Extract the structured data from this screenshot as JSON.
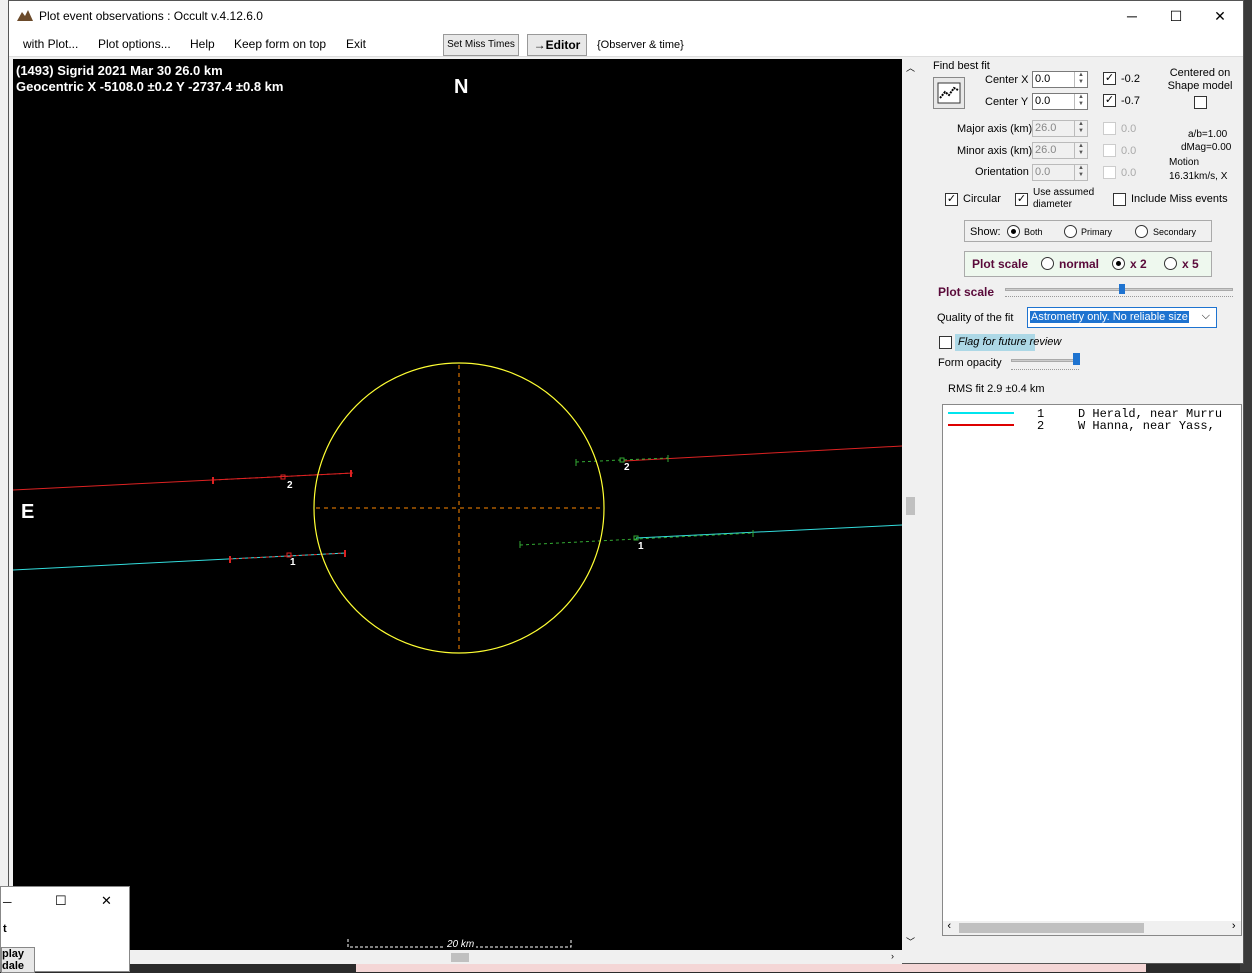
{
  "window": {
    "title": "Plot event observations : Occult v.4.12.6.0",
    "minimize": "─",
    "maximize": "☐",
    "close": "✕"
  },
  "menu": {
    "with_plot": "with Plot...",
    "plot_options": "Plot options...",
    "help": "Help",
    "keep_on_top": "Keep form on top",
    "exit": "Exit",
    "set_miss_times": "Set Miss Times",
    "editor": "→Editor",
    "observer_time": "{Observer & time}"
  },
  "plot": {
    "line1": "(1493) Sigrid  2021 Mar 30   26.0 km",
    "line2": "Geocentric  X  -5108.0 ±0.2  Y -2737.4 ±0.8 km",
    "north": "N",
    "east": "E",
    "scale_label": "20 km",
    "chord_labels": [
      "2",
      "1",
      "2",
      "1"
    ],
    "colors": {
      "ellipse": "#ffff33",
      "cyan": "#33dddd",
      "red": "#dd2222",
      "green": "#33aa33",
      "axes": "#ff8800"
    }
  },
  "panel": {
    "find_best_fit": "Find best fit",
    "center_x_label": "Center X",
    "center_x": "0.0",
    "center_y_label": "Center Y",
    "center_y": "0.0",
    "cx_fit": "-0.2",
    "cy_fit": "-0.7",
    "centered_on": "Centered on Shape model",
    "major_label": "Major axis (km)",
    "major": "26.0",
    "minor_label": "Minor axis (km)",
    "minor": "26.0",
    "orient_label": "Orientation",
    "orient": "0.0",
    "major_fit": "0.0",
    "minor_fit": "0.0",
    "orient_fit": "0.0",
    "ab": "a/b=1.00",
    "dmag": "dMag=0.00",
    "motion_label": "Motion",
    "motion": "16.31km/s, X",
    "circular": "Circular",
    "use_assumed": "Use assumed diameter",
    "include_miss": "Include Miss events",
    "show_label": "Show:",
    "show_both": "Both",
    "show_primary": "Primary",
    "show_secondary": "Secondary",
    "plot_scale_label": "Plot scale",
    "scale_normal": "normal",
    "scale_x2": "x 2",
    "scale_x5": "x 5",
    "plot_scale_slider_label": "Plot scale",
    "quality_label": "Quality of the fit",
    "quality_value": "Astrometry only. No reliable size",
    "flag_review": "Flag for future review",
    "form_opacity": "Form opacity",
    "rms_fit": "RMS fit 2.9 ±0.4 km"
  },
  "observers": [
    {
      "num": "1",
      "text": "D Herald, near Murru",
      "color": "#00e5ee"
    },
    {
      "num": "2",
      "text": "W Hanna, near Yass,",
      "color": "#dd0000"
    }
  ],
  "mini_window": {
    "t": "t",
    "play": "play",
    "dale": "dale"
  }
}
